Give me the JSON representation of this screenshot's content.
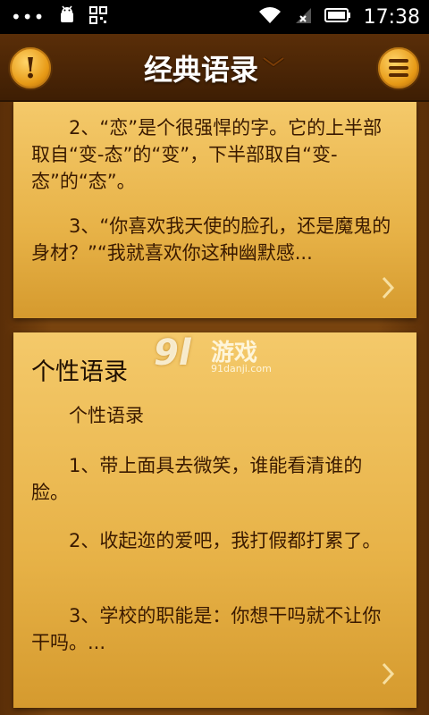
{
  "status_bar": {
    "icons": [
      "more-dots-icon",
      "android-debug-icon",
      "qr-icon",
      "wifi-icon",
      "no-signal-icon",
      "battery-icon"
    ],
    "dots": "•••",
    "time": "17:38"
  },
  "header": {
    "title": "经典语录",
    "left_button_glyph": "!",
    "colors": {
      "accent": "#e79a16",
      "bar": "#4a2406"
    }
  },
  "cards": [
    {
      "paragraphs": [
        "2、“恋”是个很强悍的字。它的上半部取自“变-态”的“变”，下半部取自“变-态”的“态”。",
        "3、“你喜欢我天使的脸孔，还是魔鬼的身材？”“我就喜欢你这种幽默感..."
      ]
    },
    {
      "heading": "个性语录",
      "paragraphs": [
        "个性语录",
        "1、带上面具去微笑，谁能看清谁的脸。",
        "2、收起迩的爱吧，我打假都打累了。",
        "3、学校的职能是：你想干吗就不让你干吗。..."
      ]
    }
  ],
  "watermark": {
    "logo": "9l",
    "text": "游戏",
    "url": "91danji.com"
  },
  "colors": {
    "card": "#e9b54d",
    "text": "#3a1a00",
    "background": "#6b3a0c"
  }
}
